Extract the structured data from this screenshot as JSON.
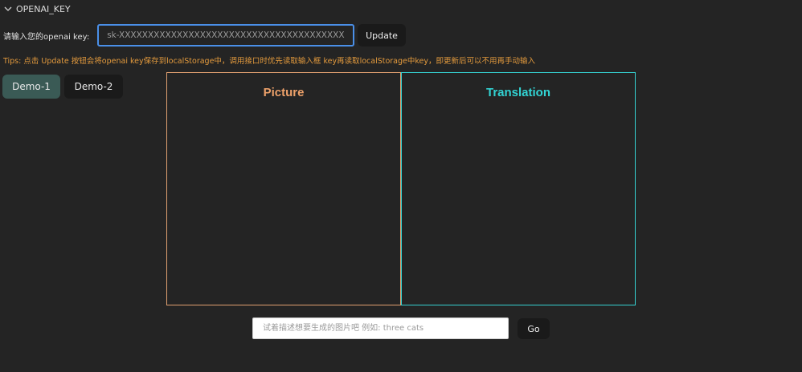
{
  "section": {
    "title": "OPENAI_KEY",
    "icon": "chevron-down-icon"
  },
  "key_form": {
    "label": "请输入您的openai key:",
    "input_value": "",
    "input_placeholder": "sk-XXXXXXXXXXXXXXXXXXXXXXXXXXXXXXXXXXXXXXXXXXXXXXXX",
    "update_label": "Update"
  },
  "tips": "Tips: 点击 Update 按钮会将openai key保存到localStorage中，调用接口时优先读取输入框 key再读取localStorage中key，即更新后可以不用再手动输入",
  "demos": [
    {
      "label": "Demo-1",
      "active": true
    },
    {
      "label": "Demo-2",
      "active": false
    }
  ],
  "panels": {
    "picture_title": "Picture",
    "translation_title": "Translation",
    "picture_color": "#eda16a",
    "translation_color": "#32d4d4"
  },
  "prompt": {
    "value": "",
    "placeholder": "试着描述想要生成的图片吧 例如: three cats",
    "go_label": "Go"
  }
}
